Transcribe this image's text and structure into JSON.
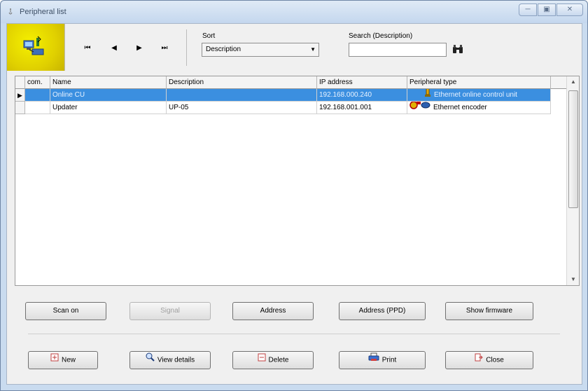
{
  "window": {
    "title": "Peripheral list",
    "minimize_glyph": "─",
    "maximize_glyph": "▣",
    "close_glyph": "✕"
  },
  "toolbar": {
    "first_glyph": "⏮",
    "prev_glyph": "◀",
    "next_glyph": "▶",
    "last_glyph": "⏭",
    "sort_label": "Sort",
    "sort_value": "Description",
    "search_label": "Search (Description)",
    "search_value": ""
  },
  "grid": {
    "columns": [
      "com.",
      "Name",
      "Description",
      "IP address",
      "Peripheral type"
    ],
    "rows": [
      {
        "com": "",
        "name": "Online CU",
        "description": "",
        "ip": "192.168.000.240",
        "type": "Ethernet online control unit",
        "selected": true
      },
      {
        "com": "",
        "name": "Updater",
        "description": "UP-05",
        "ip": "192.168.001.001",
        "type": "Ethernet encoder",
        "selected": false
      }
    ]
  },
  "actions": {
    "scan_on": "Scan on",
    "signal": "Signal",
    "address": "Address",
    "address_ppd": "Address (PPD)",
    "show_firmware": "Show firmware"
  },
  "footer": {
    "new": "New",
    "view_details": "View details",
    "delete": "Delete",
    "print": "Print",
    "close": "Close"
  },
  "colors": {
    "selection": "#3b8fe0",
    "logo": "#e8dc00"
  }
}
